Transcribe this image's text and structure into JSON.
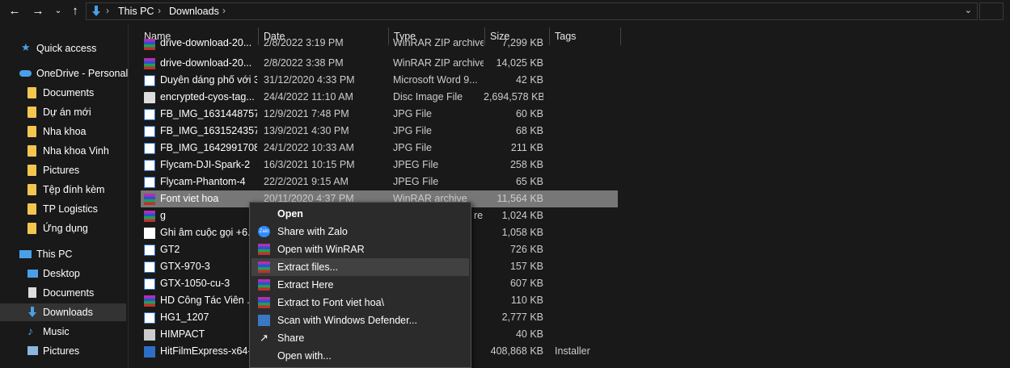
{
  "toolbar": {
    "back_icon": "arrow-left",
    "forward_icon": "arrow-right",
    "recent_icon": "chevron-down",
    "up_icon": "arrow-up"
  },
  "address": {
    "crumbs": [
      "This PC",
      "Downloads"
    ]
  },
  "nav": {
    "items": [
      {
        "label": "Quick access",
        "icon": "star-icon"
      },
      {
        "label": "OneDrive - Personal",
        "icon": "cloud-icon"
      },
      {
        "label": "Documents",
        "icon": "folder-icon"
      },
      {
        "label": "Dự án mới",
        "icon": "folder-icon"
      },
      {
        "label": "Nha khoa",
        "icon": "folder-icon"
      },
      {
        "label": "Nha khoa Vinh",
        "icon": "folder-icon"
      },
      {
        "label": "Pictures",
        "icon": "folder-icon"
      },
      {
        "label": "Tệp đính kèm",
        "icon": "folder-icon"
      },
      {
        "label": "TP Logistics",
        "icon": "folder-icon"
      },
      {
        "label": "Ứng dụng",
        "icon": "folder-icon"
      },
      {
        "label": "This PC",
        "icon": "computer-icon"
      },
      {
        "label": "Desktop",
        "icon": "desktop-icon"
      },
      {
        "label": "Documents",
        "icon": "documents-icon"
      },
      {
        "label": "Downloads",
        "icon": "download-icon"
      },
      {
        "label": "Music",
        "icon": "music-icon"
      },
      {
        "label": "Pictures",
        "icon": "pictures-icon"
      }
    ]
  },
  "columns": {
    "name": "Name",
    "date": "Date",
    "type": "Type",
    "size": "Size",
    "tags": "Tags"
  },
  "files": [
    {
      "name": "drive-download-20...",
      "date": "2/8/2022 3:19 PM",
      "type": "WinRAR ZIP archive",
      "size": "7,299 KB",
      "tags": ""
    },
    {
      "name": "drive-download-20...",
      "date": "2/8/2022 3:38 PM",
      "type": "WinRAR ZIP archive",
      "size": "14,025 KB",
      "tags": ""
    },
    {
      "name": "Duyên dáng phố với 3...",
      "date": "31/12/2020 4:33 PM",
      "type": "Microsoft Word 9...",
      "size": "42 KB",
      "tags": ""
    },
    {
      "name": "encrypted-cyos-tag...",
      "date": "24/4/2022 11:10 AM",
      "type": "Disc Image File",
      "size": "2,694,578 KB",
      "tags": ""
    },
    {
      "name": "FB_IMG_1631448757...",
      "date": "12/9/2021 7:48 PM",
      "type": "JPG File",
      "size": "60 KB",
      "tags": ""
    },
    {
      "name": "FB_IMG_1631524357...",
      "date": "13/9/2021 4:30 PM",
      "type": "JPG File",
      "size": "68 KB",
      "tags": ""
    },
    {
      "name": "FB_IMG_1642991708...",
      "date": "24/1/2022 10:33 AM",
      "type": "JPG File",
      "size": "211 KB",
      "tags": ""
    },
    {
      "name": "Flycam-DJI-Spark-2",
      "date": "16/3/2021 10:15 PM",
      "type": "JPEG File",
      "size": "258 KB",
      "tags": ""
    },
    {
      "name": "Flycam-Phantom-4",
      "date": "22/2/2021 9:15 AM",
      "type": "JPEG File",
      "size": "65 KB",
      "tags": ""
    },
    {
      "name": "Font viet hoa",
      "date": "20/11/2020 4:37 PM",
      "type": "WinRAR archive",
      "size": "11,564 KB",
      "tags": ""
    },
    {
      "name": "g",
      "date": "",
      "type": "re",
      "size": "1,024 KB",
      "tags": ""
    },
    {
      "name": "Ghi âm cuộc gọi +6...",
      "date": "",
      "type": "",
      "size": "1,058 KB",
      "tags": ""
    },
    {
      "name": "GT2",
      "date": "",
      "type": "",
      "size": "726 KB",
      "tags": ""
    },
    {
      "name": "GTX-970-3",
      "date": "",
      "type": "",
      "size": "157 KB",
      "tags": ""
    },
    {
      "name": "GTX-1050-cu-3",
      "date": "",
      "type": "",
      "size": "607 KB",
      "tags": ""
    },
    {
      "name": "HD Công Tác Viên ...",
      "date": "",
      "type": "",
      "size": "110 KB",
      "tags": ""
    },
    {
      "name": "HG1_1207",
      "date": "",
      "type": "",
      "size": "2,777 KB",
      "tags": ""
    },
    {
      "name": "HIMPACT",
      "date": "",
      "type": "",
      "size": "40 KB",
      "tags": ""
    },
    {
      "name": "HitFilmExpress-x64-...",
      "date": "",
      "type": "",
      "size": "408,868 KB",
      "tags": "Installer"
    }
  ],
  "context_menu": {
    "items": [
      {
        "label": "Open",
        "icon": "",
        "bold": true
      },
      {
        "label": "Share with Zalo",
        "icon": "zalo-icon"
      },
      {
        "label": "Open with WinRAR",
        "icon": "winrar-icon"
      },
      {
        "label": "Extract files...",
        "icon": "winrar-icon"
      },
      {
        "label": "Extract Here",
        "icon": "winrar-icon"
      },
      {
        "label": "Extract to Font viet hoa\\",
        "icon": "winrar-icon"
      },
      {
        "label": "Scan with Windows Defender...",
        "icon": "shield-icon"
      },
      {
        "label": "Share",
        "icon": "share-icon"
      },
      {
        "label": "Open with...",
        "icon": ""
      }
    ]
  }
}
